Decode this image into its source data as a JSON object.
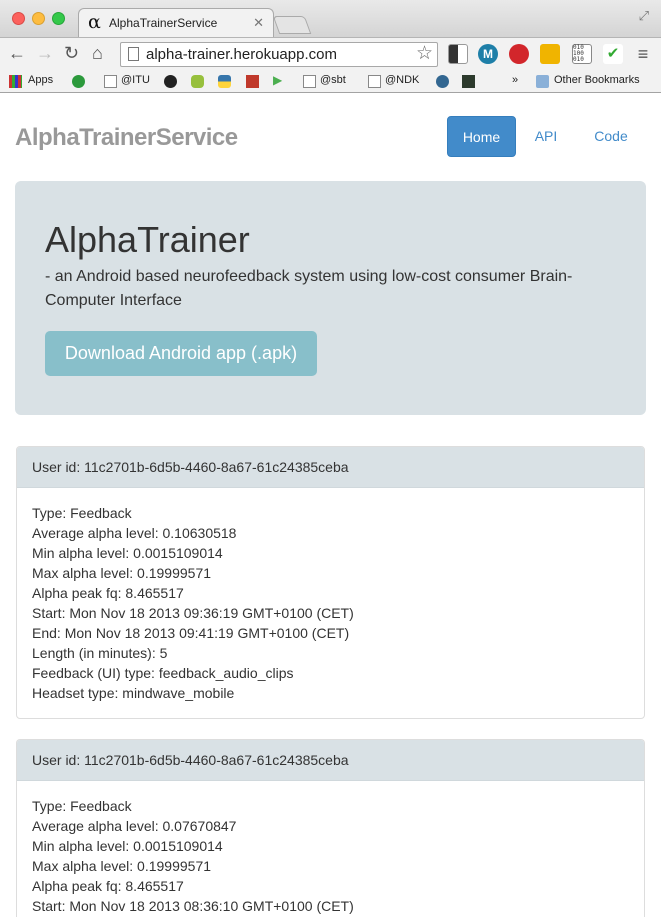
{
  "browser": {
    "tab_title": "AlphaTrainerService",
    "tab_favicon": "α",
    "tab_close": "✕",
    "url": "alpha-trainer.herokuapp.com"
  },
  "bookmarks": {
    "apps": "Apps",
    "itu": "@ITU",
    "sbt": "@sbt",
    "ndk": "@NDK",
    "more": "»",
    "other": "Other Bookmarks"
  },
  "page": {
    "brand": "AlphaTrainerService",
    "nav": [
      {
        "label": "Home"
      },
      {
        "label": "API"
      },
      {
        "label": "Code"
      }
    ],
    "jumbotron": {
      "title": "AlphaTrainer",
      "text": "- an Android based neurofeedback system using low-cost consumer Brain-Computer Interface",
      "button": "Download Android app (.apk)"
    },
    "sessions": [
      {
        "heading": "User id: 11c2701b-6d5b-4460-8a67-61c24385ceba",
        "lines": [
          "Type: Feedback",
          "Average alpha level: 0.10630518",
          "Min alpha level: 0.0015109014",
          "Max alpha level: 0.19999571",
          "Alpha peak fq: 8.465517",
          "Start: Mon Nov 18 2013 09:36:19 GMT+0100 (CET)",
          "End: Mon Nov 18 2013 09:41:19 GMT+0100 (CET)",
          "Length (in minutes): 5",
          "Feedback (UI) type: feedback_audio_clips",
          "Headset type: mindwave_mobile"
        ]
      },
      {
        "heading": "User id: 11c2701b-6d5b-4460-8a67-61c24385ceba",
        "lines": [
          "Type: Feedback",
          "Average alpha level: 0.07670847",
          "Min alpha level: 0.0015109014",
          "Max alpha level: 0.19999571",
          "Alpha peak fq: 8.465517",
          "Start: Mon Nov 18 2013 08:36:10 GMT+0100 (CET)"
        ]
      }
    ]
  },
  "colors": {
    "primary": "#428bca",
    "jumbotron_bg": "#d9e1e5",
    "download_button": "#88bfca",
    "brand_text": "#999999"
  }
}
